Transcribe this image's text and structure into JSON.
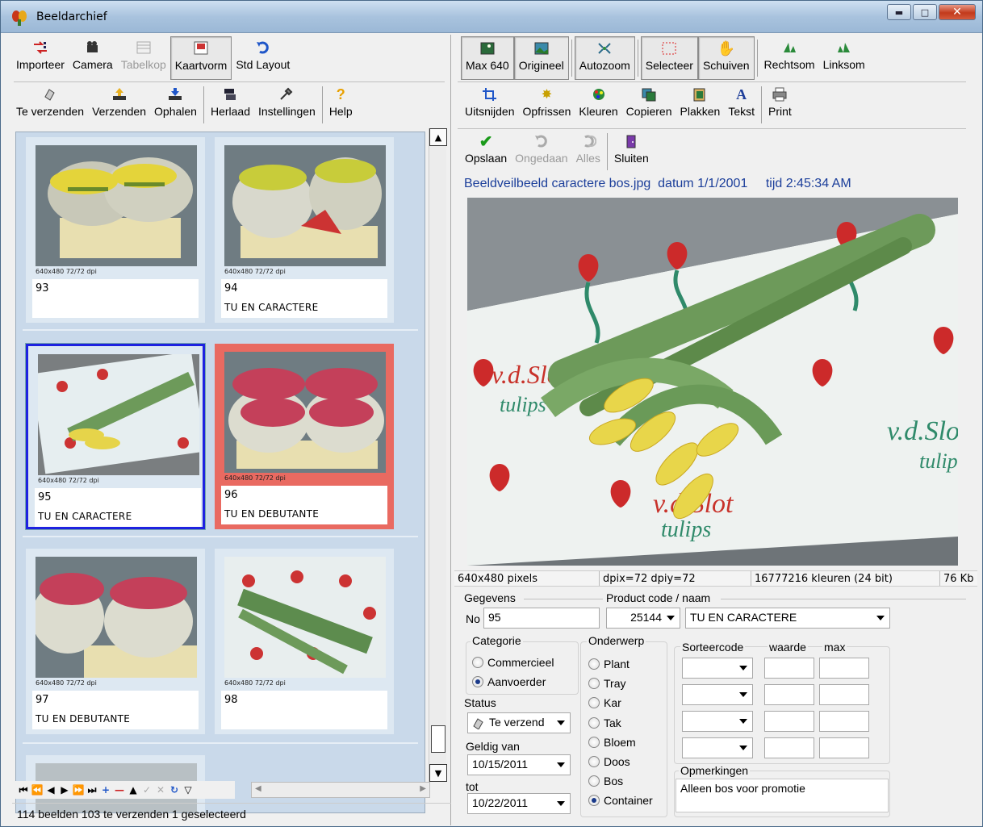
{
  "window": {
    "title": "Beeldarchief"
  },
  "left_toolbar": {
    "row1": [
      {
        "label": "Importeer",
        "icon": "import-icon"
      },
      {
        "label": "Camera",
        "icon": "camera-icon"
      },
      {
        "label": "Tabelkop",
        "icon": "table-icon",
        "disabled": true
      },
      {
        "label": "Kaartvorm",
        "icon": "card-view-icon",
        "pressed": true
      },
      {
        "label": "Std Layout",
        "icon": "undo-layout-icon"
      }
    ],
    "row2": [
      {
        "label": "Te verzenden",
        "icon": "outbox-icon"
      },
      {
        "label": "Verzenden",
        "icon": "send-icon"
      },
      {
        "label": "Ophalen",
        "icon": "receive-icon"
      },
      {
        "label": "Herlaad",
        "icon": "reload-icon"
      },
      {
        "label": "Instellingen",
        "icon": "settings-icon"
      },
      {
        "label": "Help",
        "icon": "help-icon"
      }
    ]
  },
  "thumbnails": [
    {
      "meta": "640x480 72/72 dpi",
      "number": "93",
      "name": "",
      "photo": "yellow-tulips"
    },
    {
      "meta": "640x480 72/72 dpi",
      "number": "94",
      "name": "TU EN CARACTERE",
      "photo": "yellow-tulips-2"
    },
    {
      "meta": "640x480 72/72 dpi",
      "number": "95",
      "name": "TU EN CARACTERE",
      "photo": "tulip-bunch-paper",
      "selected": true
    },
    {
      "meta": "640x480 72/72 dpi",
      "number": "96",
      "name": "TU EN DEBUTANTE",
      "photo": "red-tulips",
      "highlight": "#e96a61"
    },
    {
      "meta": "640x480 72/72 dpi",
      "number": "97",
      "name": "TU EN DEBUTANTE",
      "photo": "red-tulips-2"
    },
    {
      "meta": "640x480 72/72 dpi",
      "number": "98",
      "name": "",
      "photo": "green-bunch-paper"
    }
  ],
  "status": {
    "text": "114 beelden  103 te verzenden  1 geselecteerd"
  },
  "right_toolbar": {
    "row1": [
      {
        "label": "Max 640",
        "icon": "image-small-icon",
        "pressed": true
      },
      {
        "label": "Origineel",
        "icon": "image-original-icon",
        "pressed": true
      },
      {
        "label": "Autozoom",
        "icon": "autozoom-icon",
        "pressed": true
      },
      {
        "label": "Selecteer",
        "icon": "select-rect-icon",
        "pressed": true
      },
      {
        "label": "Schuiven",
        "icon": "hand-icon",
        "pressed": true
      },
      {
        "label": "Rechtsom",
        "icon": "rotate-right-icon"
      },
      {
        "label": "Linksom",
        "icon": "rotate-left-icon"
      }
    ],
    "row2": [
      {
        "label": "Uitsnijden",
        "icon": "crop-icon"
      },
      {
        "label": "Opfrissen",
        "icon": "sparkle-icon"
      },
      {
        "label": "Kleuren",
        "icon": "palette-icon"
      },
      {
        "label": "Copieren",
        "icon": "copy-icon"
      },
      {
        "label": "Plakken",
        "icon": "paste-icon"
      },
      {
        "label": "Tekst",
        "icon": "text-icon"
      },
      {
        "label": "Print",
        "icon": "print-icon"
      }
    ],
    "row3": [
      {
        "label": "Opslaan",
        "icon": "checkmark-icon"
      },
      {
        "label": "Ongedaan",
        "icon": "undo-icon",
        "disabled": true
      },
      {
        "label": "Alles",
        "icon": "undo-all-icon",
        "disabled": true
      },
      {
        "label": "Sluiten",
        "icon": "door-icon"
      }
    ]
  },
  "image_caption": {
    "name": "Beeldveilbeeld  caractere bos.jpg",
    "date": "datum 1/1/2001",
    "time": "tijd 2:45:34 AM"
  },
  "image_info": {
    "pixels": "640x480 pixels",
    "dpi": "dpix=72 dpiy=72",
    "colors": "16777216 kleuren (24 bit)",
    "size": "76 Kb"
  },
  "form": {
    "gegevens_label": "Gegevens",
    "product_label": "Product  code / naam",
    "no_label": "No",
    "no_value": "95",
    "code_value": "25144",
    "name_value": "TU EN CARACTERE",
    "categorie": {
      "title": "Categorie",
      "options": [
        {
          "label": "Commercieel",
          "selected": false
        },
        {
          "label": "Aanvoerder",
          "selected": true
        }
      ]
    },
    "status_label": "Status",
    "status_value": "Te verzend",
    "geldig_van_label": "Geldig van",
    "geldig_van_value": "10/15/2011",
    "tot_label": "tot",
    "tot_value": "10/22/2011",
    "onderwerp": {
      "title": "Onderwerp",
      "options": [
        {
          "label": "Plant",
          "selected": false
        },
        {
          "label": "Tray",
          "selected": false
        },
        {
          "label": "Kar",
          "selected": false
        },
        {
          "label": "Tak",
          "selected": false
        },
        {
          "label": "Bloem",
          "selected": false
        },
        {
          "label": "Doos",
          "selected": false
        },
        {
          "label": "Bos",
          "selected": false
        },
        {
          "label": "Container",
          "selected": true
        }
      ]
    },
    "sort": {
      "sorteercode_label": "Sorteercode",
      "waarde_label": "waarde",
      "max_label": "max"
    },
    "opmerkingen_label": "Opmerkingen",
    "opmerkingen_value": "Alleen bos voor promotie"
  }
}
